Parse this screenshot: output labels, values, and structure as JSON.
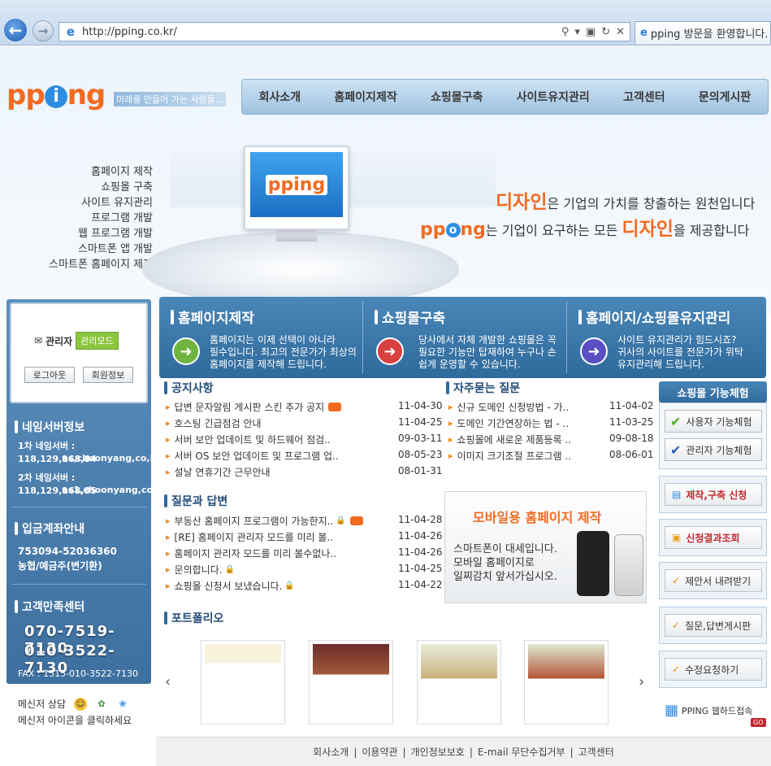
{
  "browser": {
    "url": "http://pping.co.kr/",
    "tab_title": "pping 방문을 환영합니다."
  },
  "header": {
    "logo": "pp",
    "logo_mid": "i",
    "logo_end": "ng",
    "slogan": "미래를 만들어 가는 사람들...",
    "nav": [
      "회사소개",
      "홈페이지제작",
      "쇼핑몰구축",
      "사이트유지관리",
      "고객센터",
      "문의게시판"
    ]
  },
  "visual": {
    "services": [
      "홈페이지 제작",
      "쇼핑몰 구축",
      "사이트 유지관리",
      "프로그램 개발",
      "웹 프로그램 개발",
      "스마트폰 앱 개발",
      "스마트폰 홈페이지 제작"
    ],
    "monitor_logo": "pping",
    "tag1_highlight": "디자인",
    "tag1_rest": "은 기업의 가치를 창출하는 원천입니다",
    "tag2_logo_a": "pp",
    "tag2_logo_b": "ng",
    "tag2_mid": "는 기업이 요구하는 모든 ",
    "tag2_highlight": "디자인",
    "tag2_end": "을 제공합니다"
  },
  "login": {
    "admin_label": "관리자",
    "admin_mode": "관리모드",
    "logout": "로그아웃",
    "member_info": "회원정보"
  },
  "leftbar": {
    "ns_title": "네임서버정보",
    "ns1_label": "1차 네임서버 : 118,129,168,84",
    "ns1_host": "ns,choonyang,co,kr",
    "ns2_label": "2차 네임서버 : 118,129,168,85",
    "ns2_host": "ns1,choonyang,co,kr",
    "bank_title": "입금계좌안내",
    "bank_number": "753094-52036360",
    "bank_name": "농협/예금주(변기환)",
    "cs_title": "고객만족센터",
    "phone1": "070-7519-7130",
    "phone2": "010-3522-7130",
    "fax": "FAX : 1515-010-3522-7130"
  },
  "messenger": {
    "label": "메신저 상담",
    "sub": "메신저 아이콘을 클릭하세요"
  },
  "band": [
    {
      "title": "홈페이지제작",
      "text1": "홈페이지는 이제 선택이 아니라",
      "text2": "필수입니다. 최고의 전문가가 최상의",
      "text3": "홈페이지를 제작해 드립니다."
    },
    {
      "title": "쇼핑몰구축",
      "text1": "당사에서 자체 개발한 쇼핑몰은 꼭",
      "text2": "필요한 기능만 탑재하여 누구나 손",
      "text3": "쉽게 운영할 수 있습니다."
    },
    {
      "title": "홈페이지/쇼핑몰유지관리",
      "text1": "사이트 유지관리가 힘드시죠?",
      "text2": "귀사의 사이트를 전문가가 위탁",
      "text3": "유지관리해 드립니다."
    }
  ],
  "notice": {
    "title": "공지사항",
    "posts": [
      {
        "title": "답변 문자알림 게시판 스킨 추가 공지",
        "date": "11-04-30"
      },
      {
        "title": "호스팅 긴급점검 안내",
        "date": "11-04-25"
      },
      {
        "title": "서버 보안 업데이트 및 하드웨어 점검..",
        "date": "09-03-11"
      },
      {
        "title": "서버 OS 보안 업데이트 및 프로그램 업..",
        "date": "08-05-23"
      },
      {
        "title": "설날 연휴기간 근무안내",
        "date": "08-01-31"
      }
    ]
  },
  "faq": {
    "title": "자주묻는 질문",
    "posts": [
      {
        "title": "신규 도메인 신청방법 - 가..",
        "date": "11-04-02"
      },
      {
        "title": "도메인 기간연장하는 법 - ..",
        "date": "11-03-25"
      },
      {
        "title": "쇼핑몰에 새로운 제품등록 ..",
        "date": "09-08-18"
      },
      {
        "title": "이미지 크기조절 프로그램 ..",
        "date": "08-06-01"
      }
    ]
  },
  "qna": {
    "title": "질문과 답변",
    "posts": [
      {
        "title": "부동산 홈페이지 프로그램이 가능한지..",
        "date": "11-04-28"
      },
      {
        "title": "[RE] 홈페이지 관리자 모드를 미리 볼..",
        "date": "11-04-26"
      },
      {
        "title": "홈페이지 관리자 모드를 미리 볼수없나..",
        "date": "11-04-26"
      },
      {
        "title": "문의합니다.",
        "date": "11-04-25"
      },
      {
        "title": "쇼핑몰 신청서 보냈습니다.",
        "date": "11-04-22"
      }
    ]
  },
  "mobile_banner": {
    "title": "모바일용 홈페이지 제작",
    "line1": "스마트폰이 대세입니다.",
    "line2": "모바일 홈페이지로",
    "line3": "일찌감치 앞서가십시오."
  },
  "portfolio": {
    "title": "포트폴리오",
    "prev": "‹",
    "next": "›"
  },
  "rightcol": {
    "title": "쇼핑몰 기능체험",
    "user_demo": "사용자 기능체험",
    "admin_demo": "관리자 기능체험",
    "apply": "제작,구축 신청",
    "result": "신청결과조회",
    "proposal": "제안서 내려받기",
    "qna_board": "질문,답변게시판",
    "modify": "수정요청하기",
    "webhard": "PPING 웹하드접속",
    "go": "GO"
  },
  "footer": {
    "links": [
      "회사소개",
      "이용약관",
      "개인정보보호",
      "E-mail 무단수집거부",
      "고객센터"
    ]
  },
  "colors": {
    "brand_orange": "#f26b21",
    "brand_blue": "#2d8de0",
    "panel_blue": "#3d6f9f"
  }
}
